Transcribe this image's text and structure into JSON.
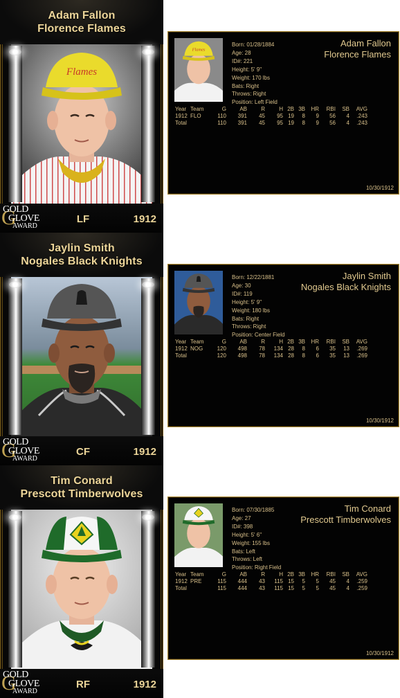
{
  "players": [
    {
      "name": "Adam Fallon",
      "team": "Florence Flames",
      "position": "LF",
      "year": "1912",
      "cap_logo": "Flames",
      "award_logo": {
        "line1": "GOLD",
        "line2": "GLOVE",
        "line3": "AWARD"
      },
      "bio": {
        "born": "Born: 01/28/1884",
        "age": "Age: 28",
        "id": "ID#: 221",
        "height": "Height: 5' 9\"",
        "weight": "Weight: 170 lbs",
        "bats": "Bats: Right",
        "throws": "Throws: Right",
        "position": "Position: Left Field"
      },
      "stat_headers": [
        "Year",
        "Team",
        "G",
        "AB",
        "R",
        "H",
        "2B",
        "3B",
        "HR",
        "RBI",
        "SB",
        "AVG"
      ],
      "stat_rows": [
        [
          "1912",
          "FLO",
          "110",
          "391",
          "45",
          "95",
          "19",
          "8",
          "9",
          "56",
          "4",
          ".243"
        ],
        [
          "Total",
          "",
          "110",
          "391",
          "45",
          "95",
          "19",
          "8",
          "9",
          "56",
          "4",
          ".243"
        ]
      ],
      "date": "10/30/1912",
      "colors": {
        "cap": "#e8da2e",
        "brim": "#d8c41c",
        "jersey": "#f2f2f2",
        "pinstripe": "#c63a3a",
        "undershirt": "#d7b21e",
        "bg": "#6e6e6e"
      }
    },
    {
      "name": "Jaylin Smith",
      "team": "Nogales Black Knights",
      "position": "CF",
      "year": "1912",
      "cap_logo": "",
      "award_logo": {
        "line1": "GOLD",
        "line2": "GLOVE",
        "line3": "AWARD"
      },
      "bio": {
        "born": "Born: 12/22/1881",
        "age": "Age: 30",
        "id": "ID#: 119",
        "height": "Height: 5' 9\"",
        "weight": "Weight: 180 lbs",
        "bats": "Bats: Right",
        "throws": "Throws: Right",
        "position": "Position: Center Field"
      },
      "stat_headers": [
        "Year",
        "Team",
        "G",
        "AB",
        "R",
        "H",
        "2B",
        "3B",
        "HR",
        "RBI",
        "SB",
        "AVG"
      ],
      "stat_rows": [
        [
          "1912",
          "NOG",
          "120",
          "498",
          "78",
          "134",
          "28",
          "8",
          "6",
          "35",
          "13",
          ".269"
        ],
        [
          "Total",
          "",
          "120",
          "498",
          "78",
          "134",
          "28",
          "8",
          "6",
          "35",
          "13",
          ".269"
        ]
      ],
      "date": "10/30/1912",
      "colors": {
        "cap": "#4a4a4a",
        "brim": "#2e2e2e",
        "jersey": "#2c2c2c",
        "pinstripe": "#bdbdbd",
        "undershirt": "#1a1a1a",
        "bg": "#3f7a3a"
      }
    },
    {
      "name": "Tim Conard",
      "team": "Prescott Timberwolves",
      "position": "RF",
      "year": "1912",
      "cap_logo": "",
      "award_logo": {
        "line1": "GOLD",
        "line2": "GLOVE",
        "line3": "AWARD"
      },
      "bio": {
        "born": "Born: 07/30/1885",
        "age": "Age: 27",
        "id": "ID#: 398",
        "height": "Height: 5' 6\"",
        "weight": "Weight: 155 lbs",
        "bats": "Bats: Left",
        "throws": "Throws: Left",
        "position": "Position: Right Field"
      },
      "stat_headers": [
        "Year",
        "Team",
        "G",
        "AB",
        "R",
        "H",
        "2B",
        "3B",
        "HR",
        "RBI",
        "SB",
        "AVG"
      ],
      "stat_rows": [
        [
          "1912",
          "PRE",
          "115",
          "444",
          "43",
          "115",
          "15",
          "5",
          "5",
          "45",
          "4",
          ".259"
        ],
        [
          "Total",
          "",
          "115",
          "444",
          "43",
          "115",
          "15",
          "5",
          "5",
          "45",
          "4",
          ".259"
        ]
      ],
      "date": "10/30/1912",
      "colors": {
        "cap": "#f4f4f4",
        "brim": "#1f6b2a",
        "jersey": "#f0f0f0",
        "pinstripe": "#1f6b2a",
        "undershirt": "#161616",
        "bg": "#d9d9d9"
      }
    }
  ]
}
